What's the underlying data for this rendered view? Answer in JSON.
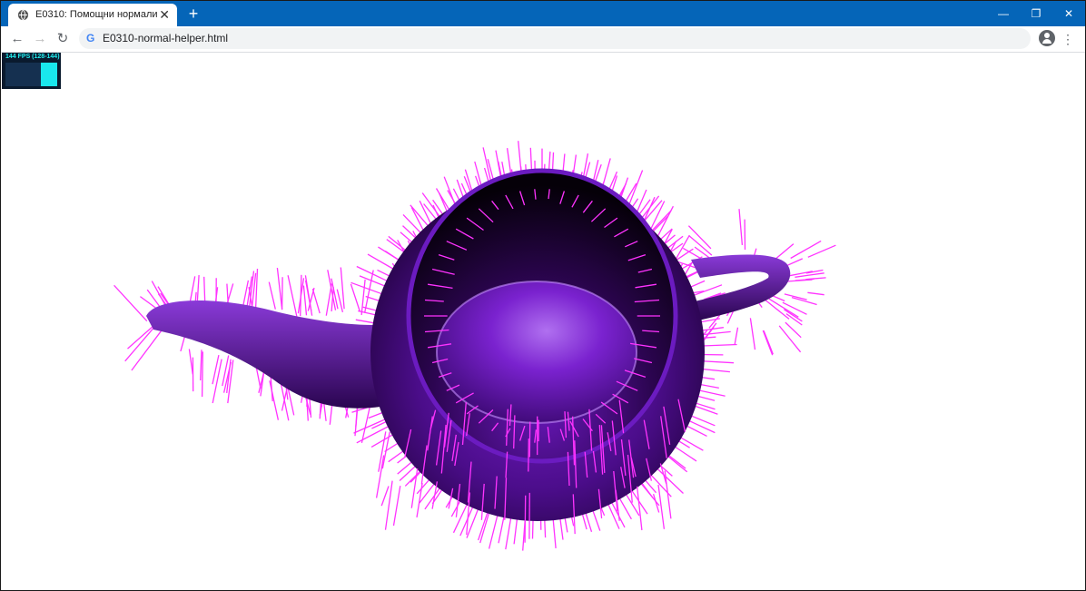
{
  "browser": {
    "tab_title": "E0310: Помощни нормали",
    "tab_close": "✕",
    "new_tab": "+",
    "url": "E0310-normal-helper.html",
    "google_letter": "G",
    "window_controls": {
      "minimize": "—",
      "restore": "❐",
      "close": "✕"
    },
    "nav": {
      "back": "←",
      "forward": "→",
      "reload": "↻"
    },
    "menu": "⋮",
    "accent_color": "#0565b8"
  },
  "stats": {
    "fps_text": "144 FPS (128-144)"
  },
  "scene": {
    "object": "teapot",
    "object_color": "#5a0f9e",
    "normals_color": "#ff33ff"
  }
}
